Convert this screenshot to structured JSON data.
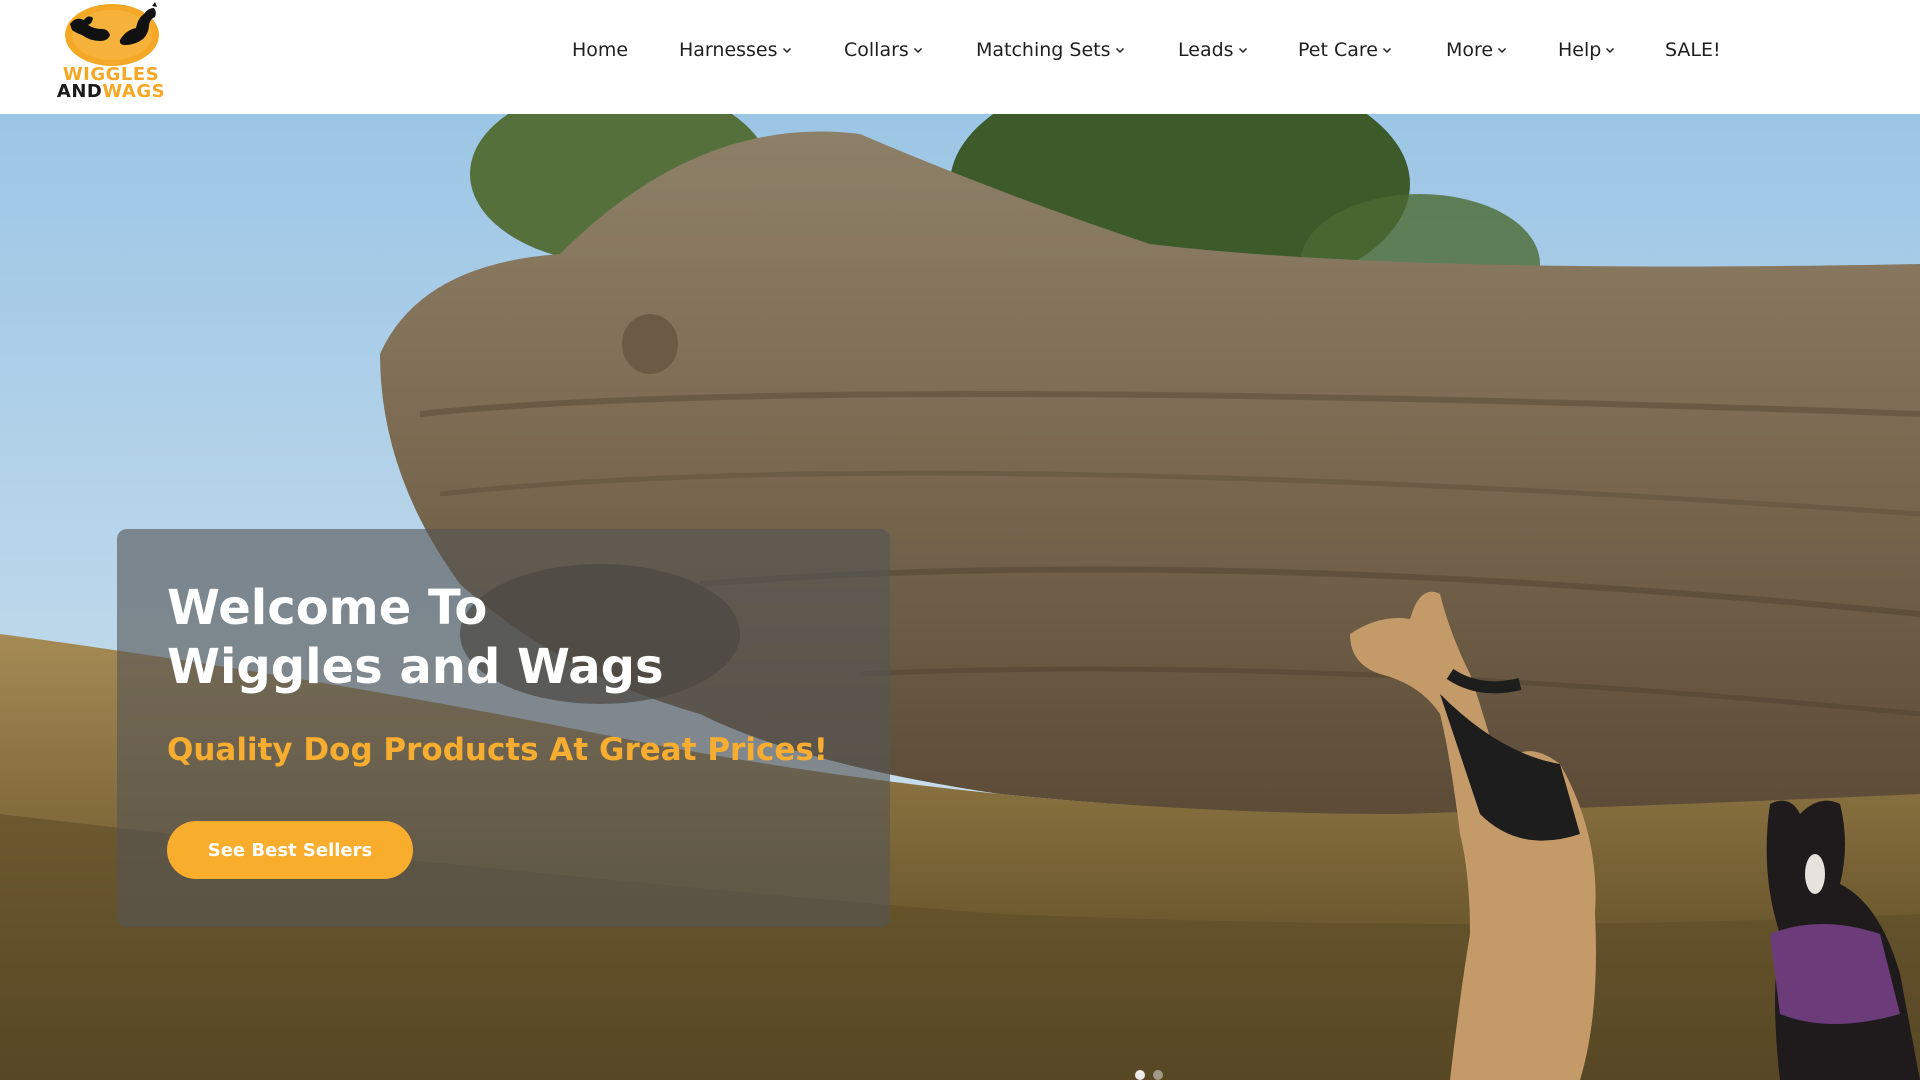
{
  "brand": {
    "logo_line1": "WIGGLES",
    "logo_line2a": "AND",
    "logo_line2b": "WAGS",
    "accent_color": "#f4a826"
  },
  "nav": {
    "items": [
      {
        "label": "Home",
        "has_dropdown": false
      },
      {
        "label": "Harnesses",
        "has_dropdown": true
      },
      {
        "label": "Collars",
        "has_dropdown": true
      },
      {
        "label": "Matching Sets",
        "has_dropdown": true
      },
      {
        "label": "Leads",
        "has_dropdown": true
      },
      {
        "label": "Pet Care",
        "has_dropdown": true
      },
      {
        "label": "More",
        "has_dropdown": true
      },
      {
        "label": "Help",
        "has_dropdown": true
      },
      {
        "label": "SALE!",
        "has_dropdown": false
      }
    ]
  },
  "hero": {
    "title_line1": "Welcome To",
    "title_line2": "Wiggles and Wags",
    "tagline": "Quality Dog Products At Great Prices!",
    "cta_label": "See Best Sellers",
    "tagline_color": "#f7ad2f",
    "cta_color": "#f9ad2c",
    "background_image": "photo of two dogs in harnesses sitting in tall grass beside a large fallen tree log"
  },
  "slider": {
    "dot_count": 2,
    "active_index": 0
  },
  "icons": {
    "dropdown": "chevron-down-icon",
    "logo": "dogs-logo-icon"
  }
}
